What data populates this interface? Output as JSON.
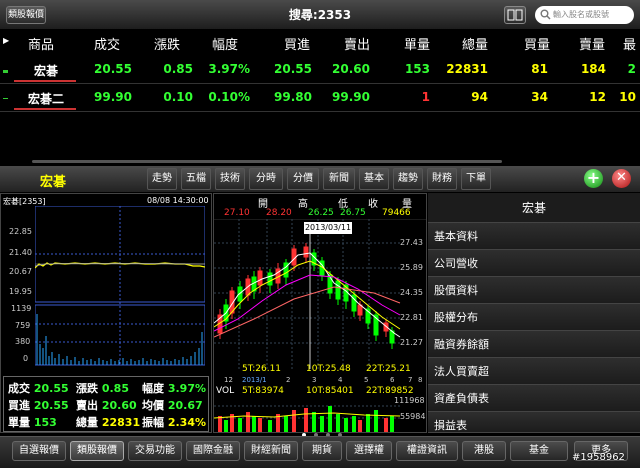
{
  "topbar": {
    "category_button": "類股報價",
    "title": "搜尋:2353",
    "search_placeholder": "輸入股名或股號"
  },
  "table": {
    "headers": [
      "商品",
      "成交",
      "漲跌",
      "幅度",
      "買進",
      "賣出",
      "單量",
      "總量",
      "買量",
      "賣量",
      "最"
    ],
    "rows": [
      {
        "name": "宏碁",
        "price": "20.55",
        "change": "0.85",
        "pct": "3.97%",
        "bid": "20.55",
        "ask": "20.60",
        "vol": "153",
        "total": "22831",
        "bidvol": "81",
        "askvol": "184",
        "extra": "2"
      },
      {
        "name": "宏碁二",
        "price": "99.90",
        "change": "0.10",
        "pct": "0.10%",
        "bid": "99.80",
        "ask": "99.90",
        "vol": "1",
        "total": "94",
        "bidvol": "34",
        "askvol": "12",
        "extra": "10"
      }
    ]
  },
  "toolbar": {
    "stock_name": "宏碁",
    "tabs": [
      "走勢",
      "五檔",
      "技術",
      "分時",
      "分價",
      "新聞",
      "基本",
      "趨勢",
      "財務",
      "下單"
    ]
  },
  "intraday": {
    "code": "宏碁[2353]",
    "datetime": "08/08 14:30:00",
    "price_ticks": [
      "22.85",
      "21.40",
      "20.67",
      "19.95"
    ],
    "volume_ticks": [
      "1139",
      "759",
      "380",
      "0"
    ]
  },
  "quote": {
    "rows": [
      [
        {
          "k": "成交",
          "v": "20.55"
        },
        {
          "k": "漲跌",
          "v": "0.85"
        },
        {
          "k": "幅度",
          "v": "3.97%"
        }
      ],
      [
        {
          "k": "買進",
          "v": "20.55"
        },
        {
          "k": "賣出",
          "v": "20.60"
        },
        {
          "k": "均價",
          "v": "20.67"
        }
      ],
      [
        {
          "k": "單量",
          "v": "153"
        },
        {
          "k": "總量",
          "v": "22831"
        },
        {
          "k": "振幅",
          "v": "2.34%"
        }
      ]
    ]
  },
  "kline": {
    "headers": [
      "開",
      "高",
      "低",
      "收",
      "量"
    ],
    "values": [
      "27.10",
      "28.20",
      "26.25",
      "26.75",
      "79466"
    ],
    "date_tooltip": "2013/03/11",
    "price_ticks": [
      "27.43",
      "25.89",
      "24.35",
      "22.81",
      "21.27"
    ],
    "ma_labels": [
      "5T:26.11",
      "10T:25.48",
      "22T:25.21"
    ],
    "axis_labels": [
      "12",
      "2013/1",
      "2",
      "3",
      "4",
      "5",
      "6",
      "7",
      "8"
    ],
    "vol_labels": [
      "VOL",
      "5T:83974",
      "10T:85401",
      "22T:89852"
    ],
    "vol_ticks": [
      "111968",
      "55984"
    ]
  },
  "menu": {
    "title": "宏碁",
    "items": [
      "基本資料",
      "公司營收",
      "股價資料",
      "股權分布",
      "融資券餘額",
      "法人買賣超",
      "資產負債表",
      "損益表"
    ]
  },
  "bottom": {
    "tabs": [
      "自選報價",
      "類股報價",
      "交易功能",
      "國際金融",
      "財經新聞",
      "期貨",
      "選擇權",
      "權證資訊",
      "港股",
      "基金",
      "更多"
    ],
    "active": "類股報價"
  },
  "watermark": "#1958962"
}
